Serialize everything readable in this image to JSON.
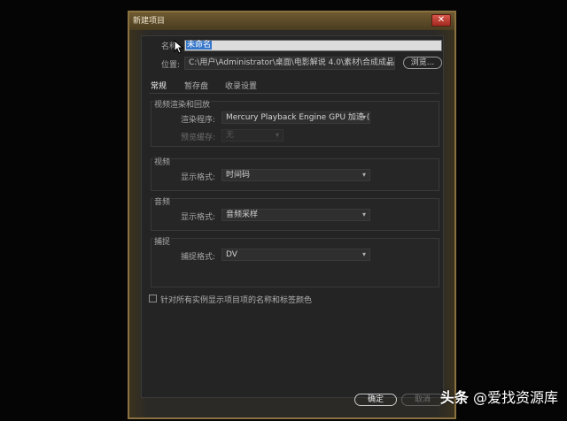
{
  "window": {
    "title": "新建项目",
    "close_label": "✕"
  },
  "form": {
    "name_label": "名称:",
    "name_value": "未命名",
    "location_label": "位置:",
    "location_value": "C:\\用户\\Administrator\\桌面\\电影解说 4.0\\素材\\合成成品 ...",
    "browse_label": "浏览..."
  },
  "tabs": [
    {
      "label": "常规",
      "active": true
    },
    {
      "label": "暂存盘",
      "active": false
    },
    {
      "label": "收录设置",
      "active": false
    }
  ],
  "groups": {
    "render": {
      "title": "视频渲染和回放",
      "renderer_label": "渲染程序:",
      "renderer_value": "Mercury Playback Engine GPU 加速 (CUDA)",
      "preview_cache_label": "预览缓存:",
      "preview_cache_value": "无"
    },
    "video": {
      "title": "视频",
      "display_format_label": "显示格式:",
      "display_format_value": "时间码"
    },
    "audio": {
      "title": "音频",
      "display_format_label": "显示格式:",
      "display_format_value": "音频采样"
    },
    "capture": {
      "title": "捕捉",
      "capture_format_label": "捕捉格式:",
      "capture_format_value": "DV"
    }
  },
  "checkbox": {
    "label": "针对所有实例显示项目项的名称和标签颜色",
    "checked": false
  },
  "buttons": {
    "ok_label": "确定",
    "cancel_label": "取消"
  },
  "watermark": {
    "logo": "头条",
    "handle": "@爱找资源库"
  },
  "colors": {
    "frame_gold": "#8a7140",
    "selection_blue": "#3576c9"
  }
}
